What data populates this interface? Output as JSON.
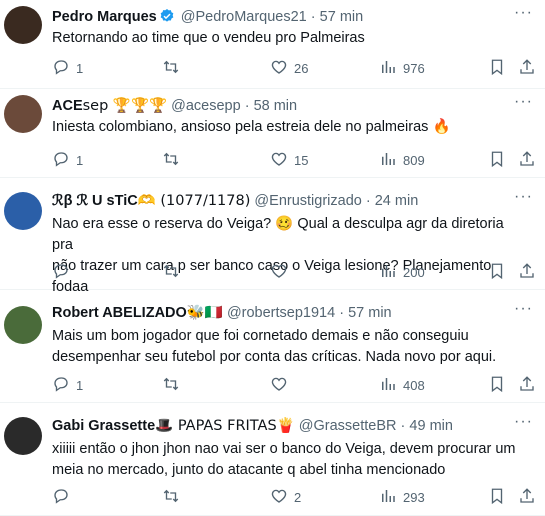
{
  "tweets": [
    {
      "avatar_color": "#3a2a20",
      "name": "Pedro Marques",
      "name_extra": "",
      "handle": "@PedroMarques21",
      "time": "57 min",
      "verified": true,
      "lines": [
        "Retornando ao time que o vendeu pro Palmeiras"
      ],
      "replies": "1",
      "retweets": "",
      "likes": "26",
      "views": "976"
    },
    {
      "avatar_color": "#6b4a3a",
      "name": "ACE",
      "name_extra": "sep 🏆🏆🏆",
      "handle": "@acesepp",
      "time": "58 min",
      "verified": false,
      "lines": [
        "Iniesta colombiano, ansioso pela estreia dele no palmeiras 🔥"
      ],
      "replies": "1",
      "retweets": "",
      "likes": "15",
      "views": "809"
    },
    {
      "avatar_color": "#2b5fa8",
      "name": "ℛβ ℛ U sTiC",
      "name_extra": "🫶 (1077/1178)",
      "handle": "@Enrustigrizado",
      "time": "24 min",
      "verified": false,
      "lines": [
        "Nao era esse o reserva do Veiga? 🥴  Qual a desculpa agr da diretoria pra",
        "não trazer um cara p ser banco caso o Veiga lesione? Planejamento fodaa"
      ],
      "replies": "",
      "retweets": "",
      "likes": "",
      "views": "200"
    },
    {
      "avatar_color": "#4a6b3a",
      "name": "Robert ABELIZADO",
      "name_extra": "🐝🇮🇹",
      "handle": "@robertsep1914",
      "time": "57 min",
      "verified": false,
      "lines": [
        "Mais um bom jogador que foi cornetado demais e não conseguiu",
        "desempenhar seu futebol por conta das críticas. Nada novo por aqui."
      ],
      "replies": "1",
      "retweets": "",
      "likes": "",
      "views": "408"
    },
    {
      "avatar_color": "#2a2a2a",
      "name": "Gabi Grassette",
      "name_extra": "🎩 PAPAS FRITAS🍟",
      "handle": "@GrassetteBR",
      "time": "49 min",
      "verified": false,
      "lines": [
        "xiiiii então o jhon jhon nao vai ser o banco do Veiga, devem procurar um",
        "meia no mercado, junto do atacante q abel tinha mencionado"
      ],
      "replies": "",
      "retweets": "",
      "likes": "2",
      "views": "293"
    }
  ]
}
